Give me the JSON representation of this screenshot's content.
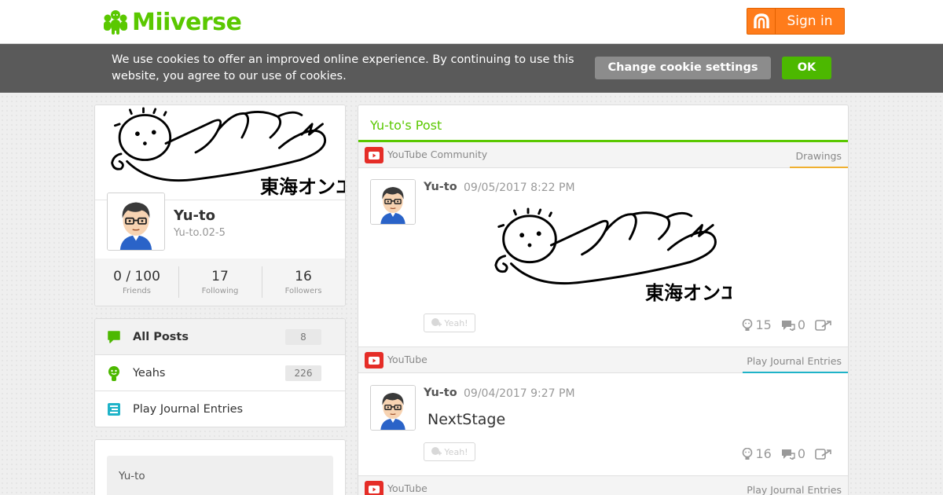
{
  "header": {
    "logo_text": "Miiverse",
    "signin_label": "Sign in",
    "brand_color": "#5ac800",
    "signin_color": "#ff7c1b"
  },
  "cookie_bar": {
    "message": "We use cookies to offer an improved online experience. By continuing to use this website, you agree to our use of cookies.",
    "settings_label": "Change cookie settings",
    "ok_label": "OK"
  },
  "profile": {
    "name": "Yu-to",
    "id": "Yu-to.02-5",
    "banner_text": "東海オンエア",
    "stats": [
      {
        "value": "0 / 100",
        "label": "Friends"
      },
      {
        "value": "17",
        "label": "Following"
      },
      {
        "value": "16",
        "label": "Followers"
      }
    ]
  },
  "nav": {
    "items": [
      {
        "label": "All Posts",
        "count": "8",
        "icon": "speech-bubble-icon"
      },
      {
        "label": "Yeahs",
        "count": "226",
        "icon": "yeah-face-icon"
      },
      {
        "label": "Play Journal Entries",
        "count": "",
        "icon": "journal-icon"
      }
    ]
  },
  "about": {
    "text": "Yu-to"
  },
  "main": {
    "title": "Yu-to's Post",
    "posts": [
      {
        "community": "YouTube Community",
        "topic": "Drawings",
        "user": "Yu-to",
        "time": "09/05/2017 8:22 PM",
        "drawing_text": "東海オンエア",
        "yeah_label": "Yeah!",
        "yeahs": "15",
        "comments": "0"
      },
      {
        "community": "YouTube",
        "topic": "Play Journal Entries",
        "user": "Yu-to",
        "time": "09/04/2017 9:27 PM",
        "text": "NextStage",
        "yeah_label": "Yeah!",
        "yeahs": "16",
        "comments": "0"
      },
      {
        "community": "YouTube",
        "topic": "Play Journal Entries"
      }
    ]
  }
}
